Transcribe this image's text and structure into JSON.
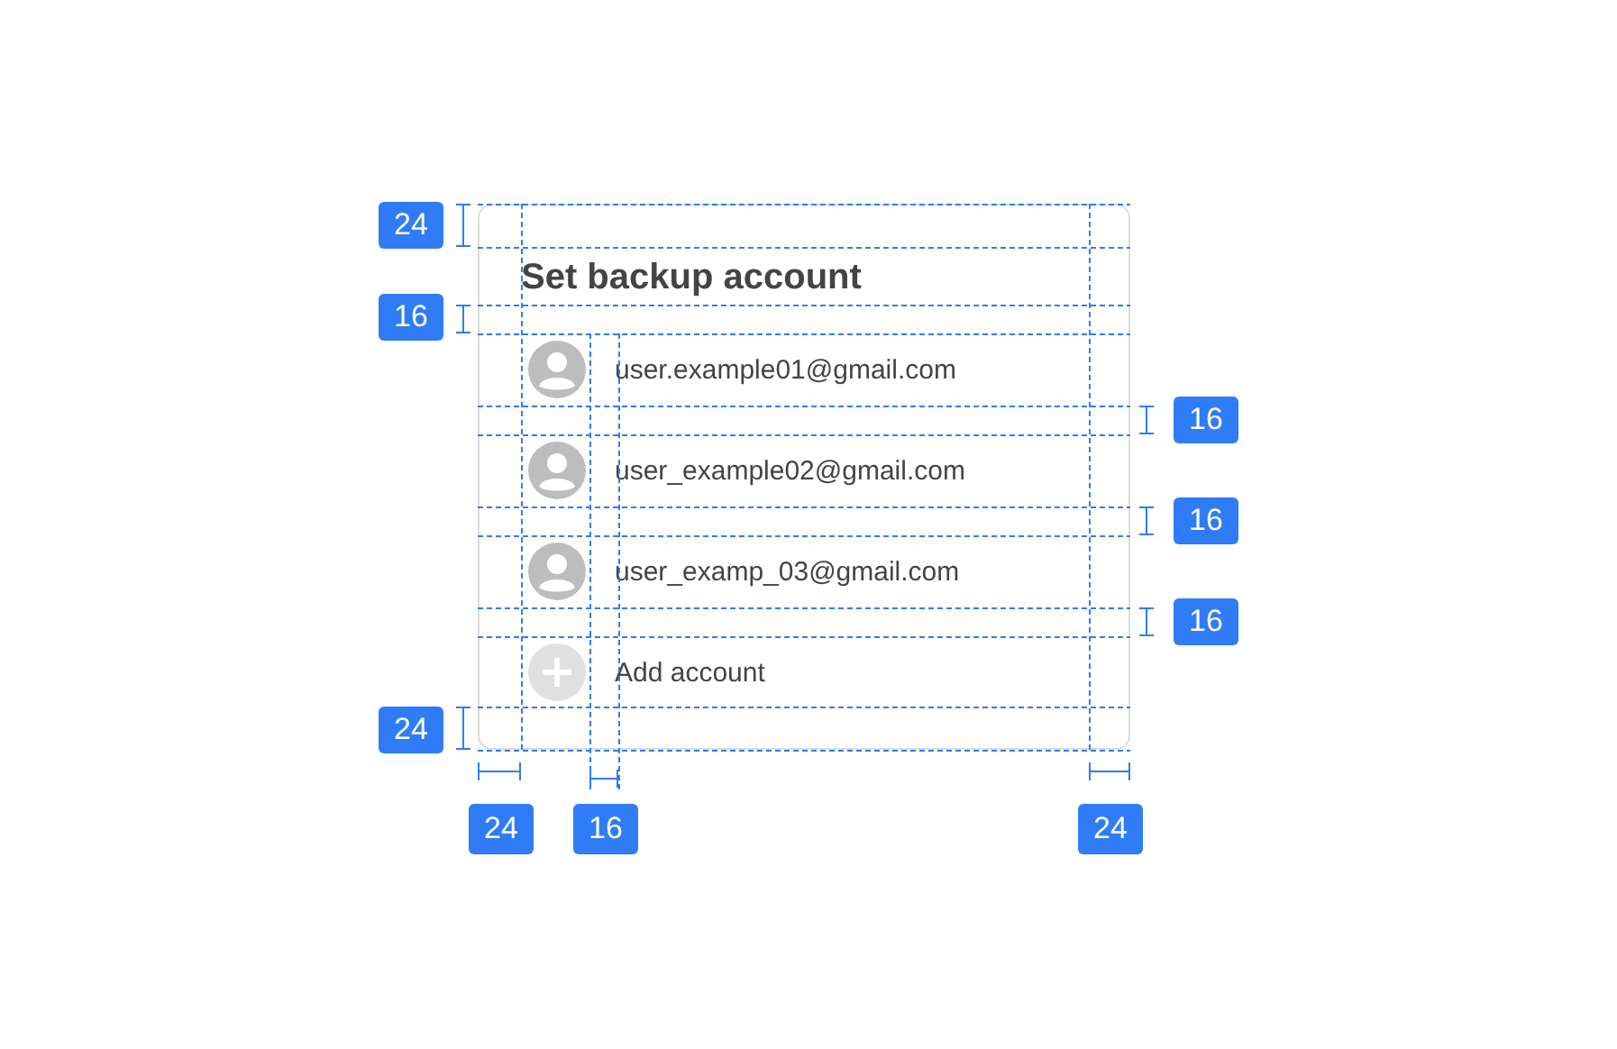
{
  "dialog": {
    "title": "Set backup account",
    "items": [
      {
        "kind": "account",
        "label": "user.example01@gmail.com"
      },
      {
        "kind": "account",
        "label": "user_example02@gmail.com"
      },
      {
        "kind": "account",
        "label": "user_examp_03@gmail.com"
      },
      {
        "kind": "add",
        "label": "Add account"
      }
    ]
  },
  "measurements": [
    "24",
    "16",
    "16",
    "16",
    "16",
    "24",
    "24",
    "16",
    "24"
  ]
}
